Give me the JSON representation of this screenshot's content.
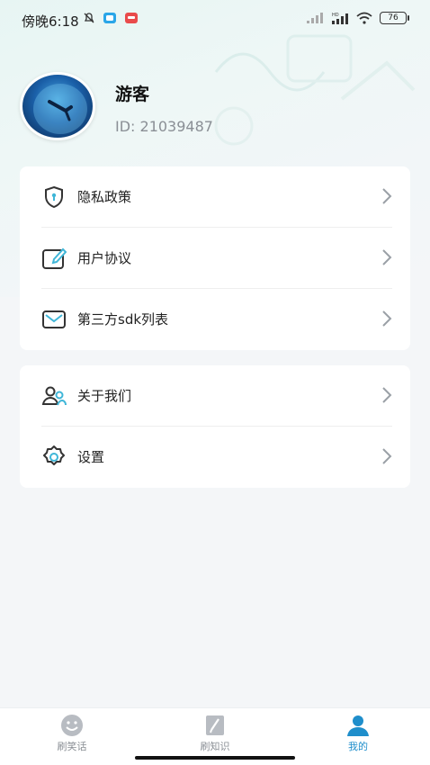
{
  "status_bar": {
    "time": "傍晚6:18",
    "battery": "76",
    "network": "HD"
  },
  "profile": {
    "name": "游客",
    "id_text": "ID: 21039487"
  },
  "menu_group_1": [
    {
      "label": "隐私政策",
      "icon": "shield-lock-icon"
    },
    {
      "label": "用户协议",
      "icon": "edit-document-icon"
    },
    {
      "label": "第三方sdk列表",
      "icon": "mail-icon"
    }
  ],
  "menu_group_2": [
    {
      "label": "关于我们",
      "icon": "users-icon"
    },
    {
      "label": "设置",
      "icon": "gear-icon"
    }
  ],
  "tabbar": {
    "items": [
      {
        "label": "刷笑话",
        "icon": "smile-icon"
      },
      {
        "label": "刷知识",
        "icon": "notebook-icon"
      },
      {
        "label": "我的",
        "icon": "person-icon"
      }
    ],
    "active_index": 2
  },
  "colors": {
    "accent": "#1f8ecb",
    "icon_teal": "#3fb6d8",
    "background": "#f4f6f8"
  }
}
